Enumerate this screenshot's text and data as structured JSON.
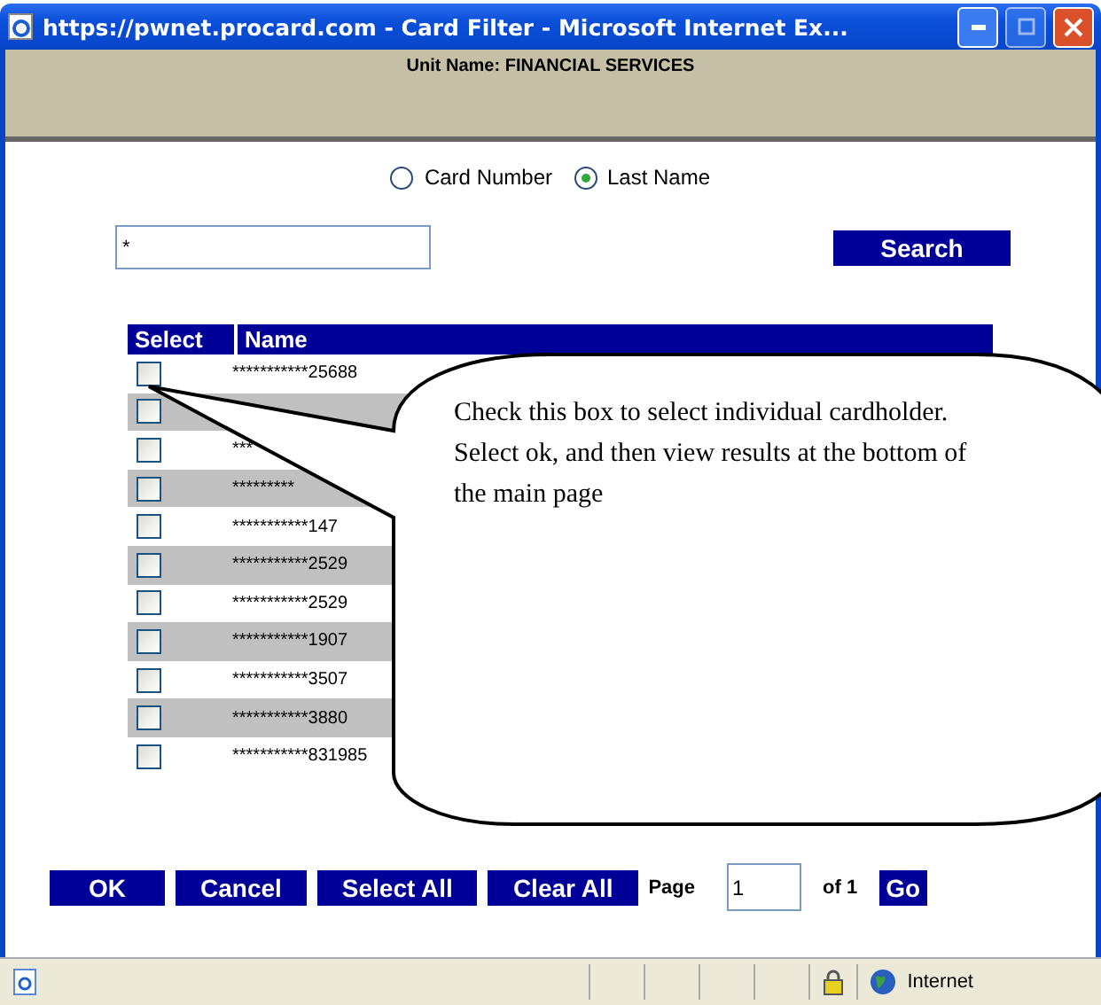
{
  "window": {
    "title": "https://pwnet.procard.com - Card Filter - Microsoft Internet Ex..."
  },
  "unit_name": "Unit Name: FINANCIAL SERVICES",
  "search_by": [
    {
      "label": "Card Number",
      "selected": false
    },
    {
      "label": "Last Name",
      "selected": true
    }
  ],
  "search": {
    "value": "*",
    "button": "Search"
  },
  "table": {
    "columns": [
      "Select",
      "Name"
    ],
    "rows": [
      {
        "name": "***********25688",
        "checked": false
      },
      {
        "checked": false
      },
      {
        "name": "***",
        "checked": false
      },
      {
        "name": "*********",
        "checked": false
      },
      {
        "name": "***********147",
        "checked": false
      },
      {
        "name": "***********2529",
        "checked": false
      },
      {
        "name": "***********2529",
        "checked": false
      },
      {
        "name": "***********1907",
        "checked": false
      },
      {
        "name": "***********3507",
        "checked": false
      },
      {
        "name": "***********3880",
        "checked": false
      },
      {
        "name": "***********831985",
        "checked": false
      }
    ]
  },
  "callout": "Check this box to select individual cardholder. Select ok, and then view results at the bottom of the main page",
  "buttons": [
    "OK",
    "Cancel",
    "Select All",
    "Clear All"
  ],
  "pager": {
    "label": "Page",
    "value": "1",
    "of": "of 1",
    "button": "Go"
  },
  "status_bar": {
    "zone": "Internet"
  }
}
